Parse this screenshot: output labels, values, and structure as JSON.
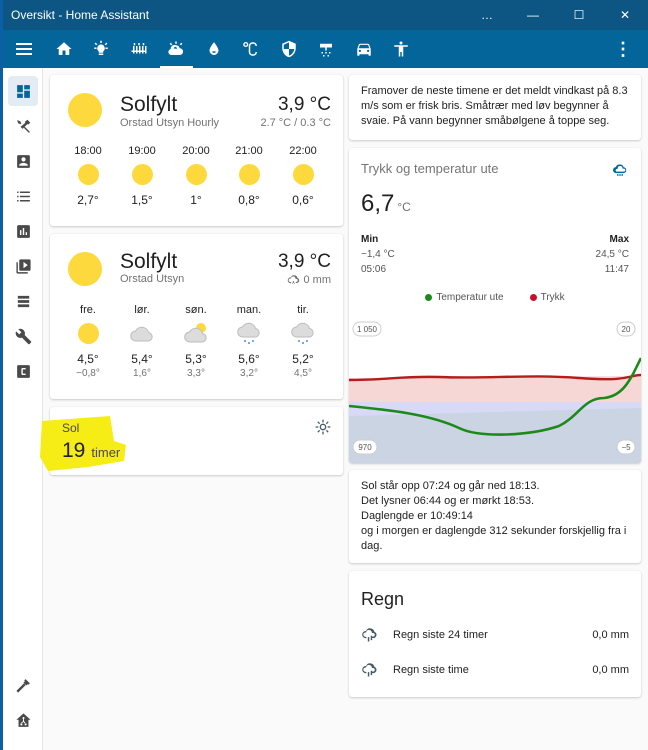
{
  "window": {
    "title": "Oversikt - Home Assistant",
    "more": "…",
    "minimize": "—",
    "maximize": "☐",
    "close": "✕"
  },
  "appbar": {
    "tabs": [
      "home-icon",
      "lightbulb-icon",
      "radiator-icon",
      "weather-icon",
      "water-drop-icon",
      "celsius-icon",
      "shield-icon",
      "shower-icon",
      "car-icon",
      "human-icon"
    ],
    "active_tab": 3,
    "menu": "⋮"
  },
  "sidebar": {
    "items": [
      "dashboard-icon",
      "tools-icon",
      "account-box-icon",
      "list-icon",
      "chart-icon",
      "media-icon",
      "server-icon",
      "wrench-icon",
      "calendar-c-icon"
    ],
    "bottom": [
      "hammer-icon",
      "home-assistant-icon"
    ]
  },
  "weather_hourly": {
    "state": "Solfylt",
    "name": "Orstad Utsyn Hourly",
    "temperature": "3,9 °C",
    "sub": "2.7 °C / 0.3 °C",
    "forecast": [
      {
        "time": "18:00",
        "temp": "2,7°",
        "icon": "sunny"
      },
      {
        "time": "19:00",
        "temp": "1,5°",
        "icon": "sunny"
      },
      {
        "time": "20:00",
        "temp": "1°",
        "icon": "sunny"
      },
      {
        "time": "21:00",
        "temp": "0,8°",
        "icon": "sunny"
      },
      {
        "time": "22:00",
        "temp": "0,6°",
        "icon": "sunny"
      }
    ]
  },
  "weather_daily": {
    "state": "Solfylt",
    "name": "Orstad Utsyn",
    "temperature": "3,9 °C",
    "precip": "0 mm",
    "forecast": [
      {
        "day": "fre.",
        "hi": "4,5°",
        "lo": "−0,8°",
        "icon": "sunny"
      },
      {
        "day": "lør.",
        "hi": "5,4°",
        "lo": "1,6°",
        "icon": "cloudy"
      },
      {
        "day": "søn.",
        "hi": "5,3°",
        "lo": "3,3°",
        "icon": "partlycloudy"
      },
      {
        "day": "man.",
        "hi": "5,6°",
        "lo": "3,2°",
        "icon": "snowy"
      },
      {
        "day": "tir.",
        "hi": "5,2°",
        "lo": "4,5°",
        "icon": "snowy"
      }
    ]
  },
  "sun_card": {
    "name": "Sol",
    "value": "19",
    "unit": "timer"
  },
  "wind_text": "Framover de neste timene er det meldt vindkast på 8.3 m/s som er frisk bris. Småtrær med løv begynner å svaie. På vann begynner småbølgene å toppe seg.",
  "pressure_card": {
    "title": "Trykk og temperatur ute",
    "value": "6,7",
    "unit": "°C",
    "min_label": "Min",
    "min_value": "−1,4 °C",
    "min_time": "05:06",
    "max_label": "Max",
    "max_value": "24,5 °C",
    "max_time": "11:47",
    "legend": [
      {
        "name": "Temperatur ute",
        "color": "#1b8a1b"
      },
      {
        "name": "Trykk",
        "color": "#c8102e"
      }
    ],
    "axis_left_top": "1 050",
    "axis_left_bottom": "970",
    "axis_right_top": "20",
    "axis_right_bottom": "−5"
  },
  "sun_text": [
    "Sol står opp 07:24 og går ned 18:13.",
    "Det lysner 06:44 og er mørkt 18:53.",
    "Daglengde er 10:49:14",
    "og i morgen er daglengde 312 sekunder forskjellig fra i dag."
  ],
  "rain_card": {
    "title": "Regn",
    "rows": [
      {
        "name": "Regn siste 24 timer",
        "value": "0,0 mm"
      },
      {
        "name": "Regn siste time",
        "value": "0,0 mm"
      }
    ]
  },
  "colors": {
    "titlebar": "#0d5683",
    "appbar": "#03659a",
    "sun": "#fdd93d",
    "highlight": "#f6ec16"
  }
}
